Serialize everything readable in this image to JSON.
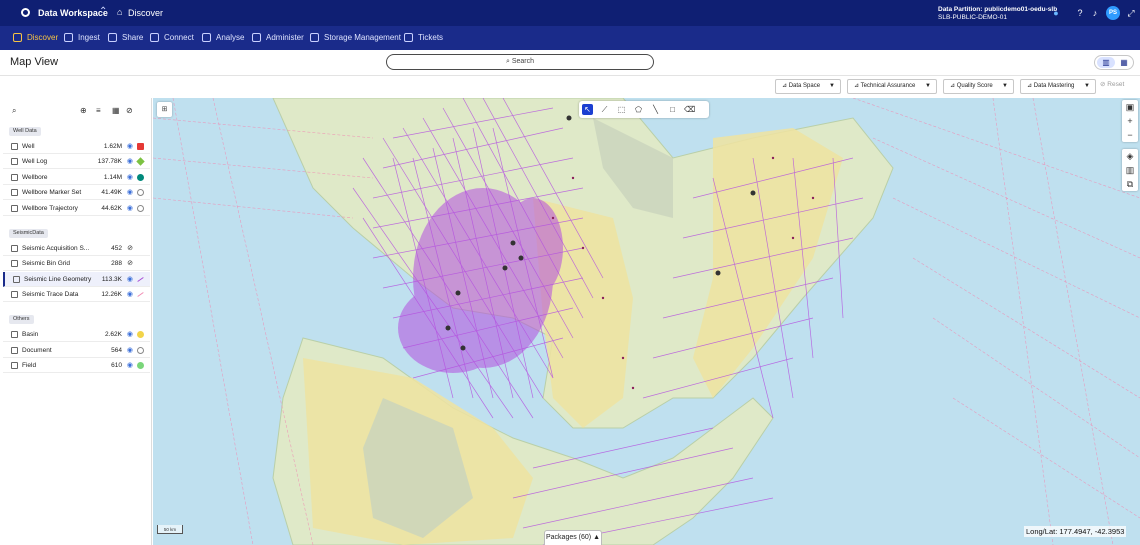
{
  "topbar": {
    "app_title": "Data Workspace",
    "breadcrumb": "Discover",
    "partition_label": "Data Partition: publicdemo01-oedu-slb",
    "partition_sub": "SLB-PUBLIC-DEMO-01",
    "avatar_initials": "PS"
  },
  "nav": {
    "items": [
      {
        "label": "Discover",
        "active": true
      },
      {
        "label": "Ingest"
      },
      {
        "label": "Share"
      },
      {
        "label": "Connect"
      },
      {
        "label": "Analyse"
      },
      {
        "label": "Administer"
      },
      {
        "label": "Storage Management"
      },
      {
        "label": "Tickets"
      }
    ]
  },
  "header": {
    "title": "Map View",
    "search_placeholder": "Search"
  },
  "filters": {
    "items": [
      {
        "label": "Data Space"
      },
      {
        "label": "Technical Assurance"
      },
      {
        "label": "Quality Score"
      },
      {
        "label": "Data Mastering"
      }
    ],
    "reset_label": "Reset"
  },
  "layers": {
    "sections": [
      {
        "title": "Well Data",
        "items": [
          {
            "name": "Well",
            "count": "1.62M",
            "color": "#e53935",
            "symbol": "square"
          },
          {
            "name": "Well Log",
            "count": "137.78K",
            "color": "#7cc242",
            "symbol": "diamond"
          },
          {
            "name": "Wellbore",
            "count": "1.14M",
            "color": "#00897b",
            "symbol": "circle"
          },
          {
            "name": "Wellbore Marker Set",
            "count": "41.49K",
            "color": "#888888",
            "symbol": "ring"
          },
          {
            "name": "Wellbore Trajectory",
            "count": "44.62K",
            "color": "#888888",
            "symbol": "ring"
          }
        ]
      },
      {
        "title": "SeismicData",
        "items": [
          {
            "name": "Seismic Acquisition S...",
            "count": "452",
            "color": "#333333",
            "symbol": "hidden"
          },
          {
            "name": "Seismic Bin Grid",
            "count": "288",
            "color": "#333333",
            "symbol": "hidden"
          },
          {
            "name": "Seismic Line Geometry",
            "count": "113.3K",
            "color": "#a64ad6",
            "symbol": "line",
            "selected": true
          },
          {
            "name": "Seismic Trace Data",
            "count": "12.26K",
            "color": "#f08ab2",
            "symbol": "line"
          }
        ]
      },
      {
        "title": "Others",
        "items": [
          {
            "name": "Basin",
            "count": "2.62K",
            "color": "#f2d44a",
            "symbol": "circle"
          },
          {
            "name": "Document",
            "count": "564",
            "color": "#888888",
            "symbol": "ring"
          },
          {
            "name": "Field",
            "count": "610",
            "color": "#7ad67a",
            "symbol": "circle"
          }
        ]
      }
    ]
  },
  "map": {
    "scale_label": "50 km",
    "packages_label": "Packages (60)",
    "longlat": "Long/Lat: 177.4947, -42.3953"
  },
  "colors": {
    "topbar": "#0f1f73",
    "navbar": "#1a2b8a",
    "active_nav": "#f6c344",
    "seismic_line": "#b44fe0",
    "sea": "#bfe0ef",
    "land": "#dfe9c8",
    "basin": "#efe3a0"
  }
}
